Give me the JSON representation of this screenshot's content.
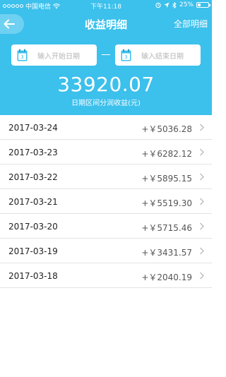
{
  "status_bar": {
    "carrier": "中国电信",
    "time": "下午11:18",
    "battery": "25%",
    "battery_level": 0.25
  },
  "nav": {
    "title": "收益明细",
    "action": "全部明细"
  },
  "filter": {
    "start_placeholder": "输入开始日期",
    "end_placeholder": "输入结束日期",
    "calendar_day": "3"
  },
  "summary": {
    "total": "33920.07",
    "label": "日期区间分润收益(元)"
  },
  "rows": [
    {
      "date": "2017-03-24",
      "amount": "+￥5036.28"
    },
    {
      "date": "2017-03-23",
      "amount": "+￥6282.12"
    },
    {
      "date": "2017-03-22",
      "amount": "+￥5895.15"
    },
    {
      "date": "2017-03-21",
      "amount": "+￥5519.30"
    },
    {
      "date": "2017-03-20",
      "amount": "+￥5715.46"
    },
    {
      "date": "2017-03-19",
      "amount": "+￥3431.57"
    },
    {
      "date": "2017-03-18",
      "amount": "+￥2040.19"
    }
  ],
  "colors": {
    "header": "#3cc0ec",
    "back_button": "#6ed1f1"
  }
}
